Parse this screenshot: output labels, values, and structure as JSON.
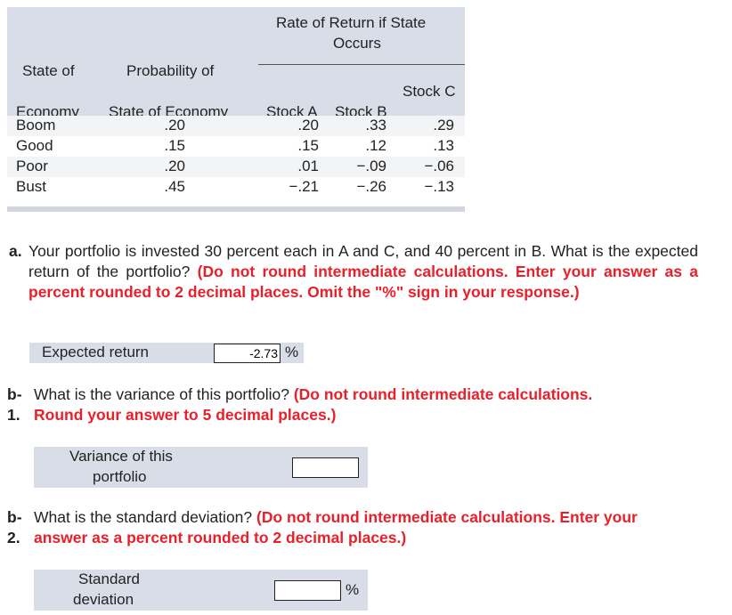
{
  "table": {
    "header": {
      "rate_of_return_line1": "Rate of Return if State",
      "rate_of_return_line2": "Occurs",
      "state_of": "State of",
      "probability_of": "Probability of",
      "economy": "Economy",
      "state_of_economy": "State of Economy",
      "stock_a": "Stock A",
      "stock_b": "Stock B",
      "stock_c": "Stock C"
    },
    "rows": [
      {
        "state": "Boom",
        "prob": ".20",
        "a": ".20",
        "b": ".33",
        "c": ".29"
      },
      {
        "state": "Good",
        "prob": ".15",
        "a": ".15",
        "b": ".12",
        "c": ".13"
      },
      {
        "state": "Poor",
        "prob": ".20",
        "a": ".01",
        "b": "−.09",
        "c": "−.06"
      },
      {
        "state": "Bust",
        "prob": ".45",
        "a": "−.21",
        "b": "−.26",
        "c": "−.13"
      }
    ]
  },
  "question_a": {
    "label": "a.",
    "text": "Your portfolio is invested 30 percent each in A and C, and 40 percent in B. What is the expected return of the portfolio?",
    "instruction": "(Do not round intermediate calculations. Enter your answer as a percent rounded to 2 decimal places. Omit the \"%\" sign in your response.)",
    "answer_label": "Expected return",
    "answer_value": "-2.73",
    "unit": "%"
  },
  "question_b1": {
    "label_top": "b-",
    "label_bottom": "1.",
    "text": "What is the variance of this portfolio?",
    "instruction_line1": "(Do not round intermediate calculations.",
    "instruction_line2": "Round your answer to 5 decimal places.)",
    "answer_label_line1": "Variance of this",
    "answer_label_line2": "portfolio",
    "answer_value": ""
  },
  "question_b2": {
    "label_top": "b-",
    "label_bottom": "2.",
    "text": "What is the standard deviation?",
    "instruction_line1": "(Do not round intermediate calculations. Enter your",
    "instruction_line2": "answer as a percent rounded to 2 decimal places.)",
    "answer_label_line1": "Standard",
    "answer_label_line2": "deviation",
    "answer_value": "",
    "unit": "%"
  }
}
